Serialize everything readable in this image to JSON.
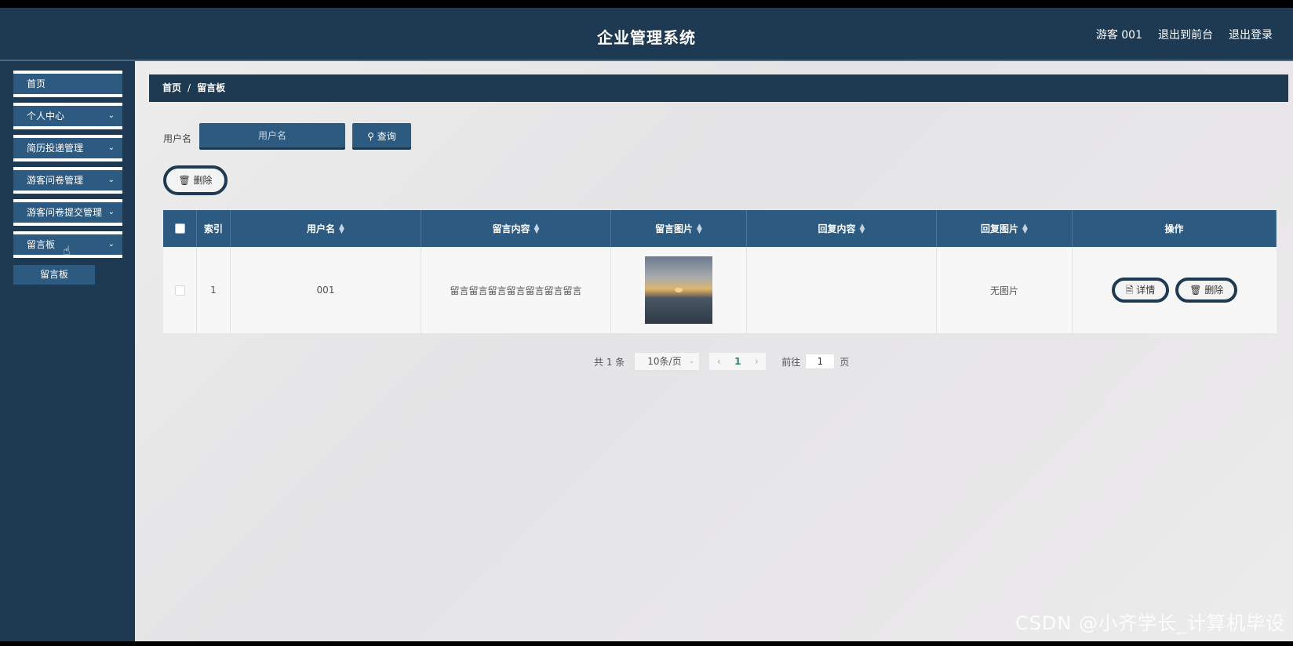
{
  "header": {
    "title": "企业管理系统",
    "user": "游客 001",
    "back_front": "退出到前台",
    "logout": "退出登录"
  },
  "sidebar": {
    "items": [
      {
        "label": "首页",
        "has_arrow": false
      },
      {
        "label": "个人中心",
        "has_arrow": true
      },
      {
        "label": "简历投递管理",
        "has_arrow": true
      },
      {
        "label": "游客问卷管理",
        "has_arrow": true
      },
      {
        "label": "游客问卷提交管理",
        "has_arrow": true
      },
      {
        "label": "留言板",
        "has_arrow": true
      }
    ],
    "submenu_item": "留言板"
  },
  "breadcrumb": {
    "home": "首页",
    "separator": "/",
    "current": "留言板"
  },
  "search": {
    "label": "用户名",
    "placeholder": "用户名",
    "button": "查询"
  },
  "actions": {
    "delete": "删除"
  },
  "table": {
    "headers": [
      "索引",
      "用户名",
      "留言内容",
      "留言图片",
      "回复内容",
      "回复图片",
      "操作"
    ],
    "rows": [
      {
        "index": "1",
        "username": "001",
        "content": "留言留言留言留言留言留言留言",
        "reply_content": "",
        "reply_image": "无图片",
        "detail_btn": "详情",
        "delete_btn": "删除"
      }
    ]
  },
  "pagination": {
    "total": "共 1 条",
    "page_size": "10条/页",
    "current_page": "1",
    "goto_label": "前往",
    "goto_value": "1",
    "page_suffix": "页"
  },
  "watermark": "CSDN @小齐学长_计算机毕设",
  "colors": {
    "header_bg": "#1e3a52",
    "accent": "#2d5a80"
  }
}
